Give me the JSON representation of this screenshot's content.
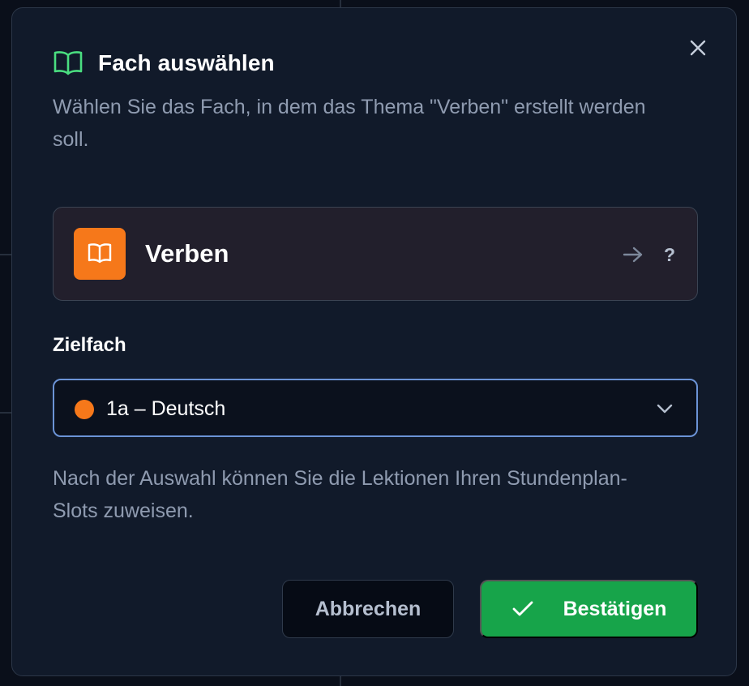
{
  "dialog": {
    "title": "Fach auswählen",
    "subtitle": "Wählen Sie das Fach, in dem das Thema \"Verben\" erstellt werden soll.",
    "close_icon": "close-icon",
    "title_icon": "book-icon"
  },
  "topic": {
    "name": "Verben",
    "icon": "book-icon",
    "arrow_icon": "arrow-right-icon",
    "help": "?"
  },
  "target": {
    "label": "Zielfach",
    "selected": "1a – Deutsch",
    "dot_color": "#f6781a",
    "chevron_icon": "chevron-down-icon"
  },
  "hint": "Nach der Auswahl können Sie die Lektionen Ihren Stundenplan-Slots zuweisen.",
  "actions": {
    "cancel_label": "Abbrechen",
    "confirm_label": "Bestätigen",
    "confirm_icon": "check-icon"
  },
  "colors": {
    "accent_green": "#17a44a",
    "accent_orange": "#f6781a",
    "focus_blue": "#6b93d6",
    "title_icon_green": "#4ade80"
  }
}
